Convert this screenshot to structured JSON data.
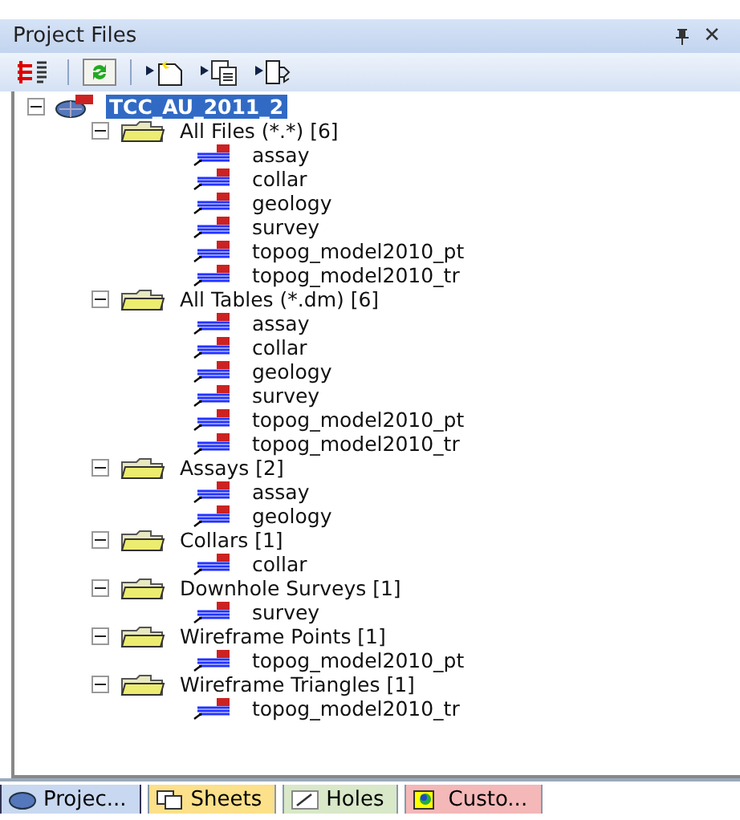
{
  "panel": {
    "title": "Project Files",
    "close": "✕"
  },
  "toolbar": [
    {
      "kind": "tree"
    },
    {
      "kind": "sep"
    },
    {
      "kind": "refresh"
    },
    {
      "kind": "sep"
    },
    {
      "kind": "new"
    },
    {
      "kind": "copy"
    },
    {
      "kind": "export"
    }
  ],
  "tree": [
    {
      "label": "TCC_AU_2011_2",
      "kind": "root",
      "selected": true,
      "expanded": true,
      "children": [
        {
          "label": "All Files (*.*) [6]",
          "kind": "folder",
          "selected": false,
          "expanded": true,
          "children": [
            {
              "label": "assay",
              "kind": "file",
              "selected": false
            },
            {
              "label": "collar",
              "kind": "file",
              "selected": false
            },
            {
              "label": "geology",
              "kind": "file",
              "selected": false
            },
            {
              "label": "survey",
              "kind": "file",
              "selected": false
            },
            {
              "label": "topog_model2010_pt",
              "kind": "file",
              "selected": false
            },
            {
              "label": "topog_model2010_tr",
              "kind": "file",
              "selected": false
            }
          ]
        },
        {
          "label": "All Tables (*.dm) [6]",
          "kind": "folder",
          "selected": false,
          "expanded": true,
          "children": [
            {
              "label": "assay",
              "kind": "file",
              "selected": false
            },
            {
              "label": "collar",
              "kind": "file",
              "selected": false
            },
            {
              "label": "geology",
              "kind": "file",
              "selected": false
            },
            {
              "label": "survey",
              "kind": "file",
              "selected": false
            },
            {
              "label": "topog_model2010_pt",
              "kind": "file",
              "selected": false
            },
            {
              "label": "topog_model2010_tr",
              "kind": "file",
              "selected": false
            }
          ]
        },
        {
          "label": "Assays [2]",
          "kind": "folder",
          "selected": false,
          "expanded": true,
          "children": [
            {
              "label": "assay",
              "kind": "file",
              "selected": false
            },
            {
              "label": "geology",
              "kind": "file",
              "selected": false
            }
          ]
        },
        {
          "label": "Collars [1]",
          "kind": "folder",
          "selected": false,
          "expanded": true,
          "children": [
            {
              "label": "collar",
              "kind": "file",
              "selected": false
            }
          ]
        },
        {
          "label": "Downhole Surveys [1]",
          "kind": "folder",
          "selected": false,
          "expanded": true,
          "children": [
            {
              "label": "survey",
              "kind": "file",
              "selected": false
            }
          ]
        },
        {
          "label": "Wireframe Points [1]",
          "kind": "folder",
          "selected": false,
          "expanded": true,
          "children": [
            {
              "label": "topog_model2010_pt",
              "kind": "file",
              "selected": false
            }
          ]
        },
        {
          "label": "Wireframe Triangles [1]",
          "kind": "folder",
          "selected": false,
          "expanded": true,
          "children": [
            {
              "label": "topog_model2010_tr",
              "kind": "file",
              "selected": false
            }
          ]
        }
      ]
    }
  ],
  "tabs": [
    {
      "label": "Projec...",
      "kind": "project",
      "selected": true,
      "color": "#c8d8f0"
    },
    {
      "label": "Sheets",
      "kind": "sheets",
      "selected": false,
      "color": "#fce08a"
    },
    {
      "label": "Holes",
      "kind": "holes",
      "selected": false,
      "color": "#d8e8c8"
    },
    {
      "label": "Custo...",
      "kind": "custom",
      "selected": false,
      "color": "#f4b8b8"
    }
  ]
}
